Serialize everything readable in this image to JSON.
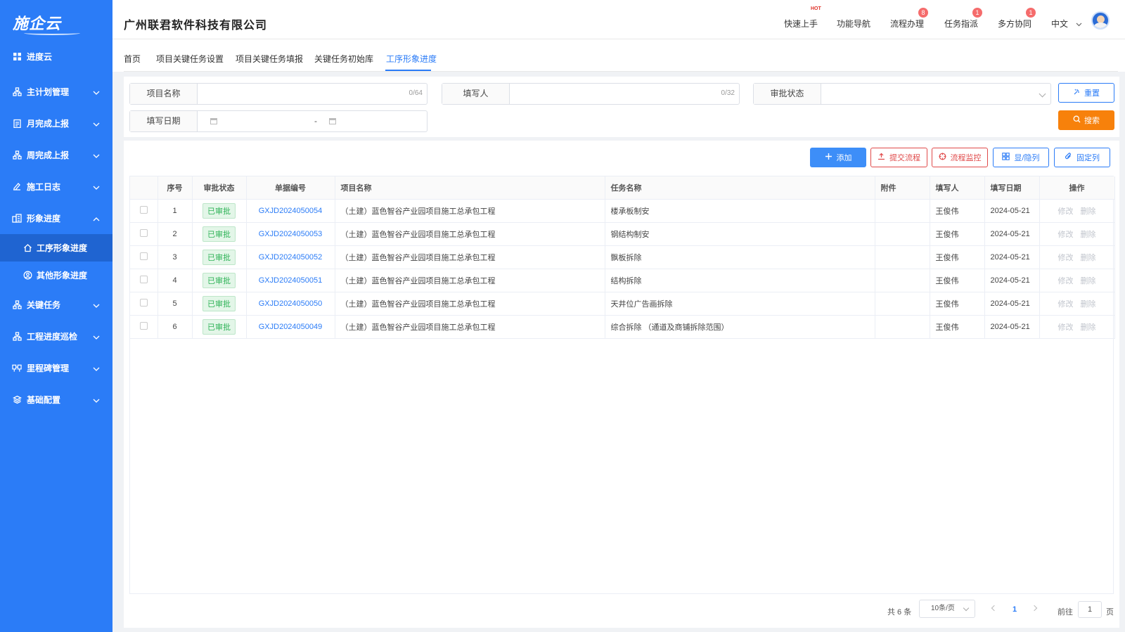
{
  "sidebar": {
    "logo": "施企云",
    "items": [
      {
        "label": "进度云"
      },
      {
        "label": "主计划管理"
      },
      {
        "label": "月完成上报"
      },
      {
        "label": "周完成上报"
      },
      {
        "label": "施工日志"
      },
      {
        "label": "形象进度"
      },
      {
        "label": "关键任务"
      },
      {
        "label": "工程进度巡检"
      },
      {
        "label": "里程碑管理"
      },
      {
        "label": "基础配置"
      }
    ],
    "sub_items": [
      {
        "label": "工序形象进度"
      },
      {
        "label": "其他形象进度"
      }
    ]
  },
  "header": {
    "company": "广州联君软件科技有限公司",
    "quick_start": "快速上手",
    "hot": "HOT",
    "nav": "功能导航",
    "flow": "流程办理",
    "flow_badge": "8",
    "task": "任务指派",
    "task_badge": "1",
    "collab": "多方协同",
    "collab_badge": "1",
    "lang": "中文"
  },
  "tabs": [
    {
      "label": "首页"
    },
    {
      "label": "项目关键任务设置"
    },
    {
      "label": "项目关键任务填报"
    },
    {
      "label": "关键任务初始库"
    },
    {
      "label": "工序形象进度"
    }
  ],
  "filter": {
    "project_name_label": "项目名称",
    "project_name_count": "0/64",
    "filler_label": "填写人",
    "filler_count": "0/32",
    "status_label": "审批状态",
    "date_label": "填写日期",
    "date_sep": "-",
    "reset": "重置",
    "search": "搜索"
  },
  "toolbar": {
    "add": "添加",
    "submit": "提交流程",
    "monitor": "流程监控",
    "toggle": "显/隐列",
    "fix": "固定列"
  },
  "table": {
    "headers": [
      "序号",
      "审批状态",
      "单据编号",
      "项目名称",
      "任务名称",
      "附件",
      "填写人",
      "填写日期",
      "操作"
    ],
    "edit": "修改",
    "delete": "删除",
    "rows": [
      {
        "no": "1",
        "status": "已审批",
        "code": "GXJD2024050054",
        "project": "（土建）蓝色智谷产业园项目施工总承包工程",
        "task": "楼承板制安",
        "filler": "王俊伟",
        "date": "2024-05-21"
      },
      {
        "no": "2",
        "status": "已审批",
        "code": "GXJD2024050053",
        "project": "（土建）蓝色智谷产业园项目施工总承包工程",
        "task": "钢结构制安",
        "filler": "王俊伟",
        "date": "2024-05-21"
      },
      {
        "no": "3",
        "status": "已审批",
        "code": "GXJD2024050052",
        "project": "（土建）蓝色智谷产业园项目施工总承包工程",
        "task": "飘板拆除",
        "filler": "王俊伟",
        "date": "2024-05-21"
      },
      {
        "no": "4",
        "status": "已审批",
        "code": "GXJD2024050051",
        "project": "（土建）蓝色智谷产业园项目施工总承包工程",
        "task": "结构拆除",
        "filler": "王俊伟",
        "date": "2024-05-21"
      },
      {
        "no": "5",
        "status": "已审批",
        "code": "GXJD2024050050",
        "project": "（土建）蓝色智谷产业园项目施工总承包工程",
        "task": "天井位广告画拆除",
        "filler": "王俊伟",
        "date": "2024-05-21"
      },
      {
        "no": "6",
        "status": "已审批",
        "code": "GXJD2024050049",
        "project": "（土建）蓝色智谷产业园项目施工总承包工程",
        "task": "综合拆除 （通道及商铺拆除范围）",
        "filler": "王俊伟",
        "date": "2024-05-21"
      }
    ]
  },
  "pager": {
    "total": "共 6 条",
    "size": "10条/页",
    "current": "1",
    "goto": "前往",
    "goto_value": "1",
    "page": "页"
  },
  "colors": {
    "sidebar_bg": "#2b7cf7",
    "accent": "#2b7cf7",
    "search_btn": "#f7810b",
    "danger": "#e04a4a",
    "approved": "#2fb358"
  }
}
